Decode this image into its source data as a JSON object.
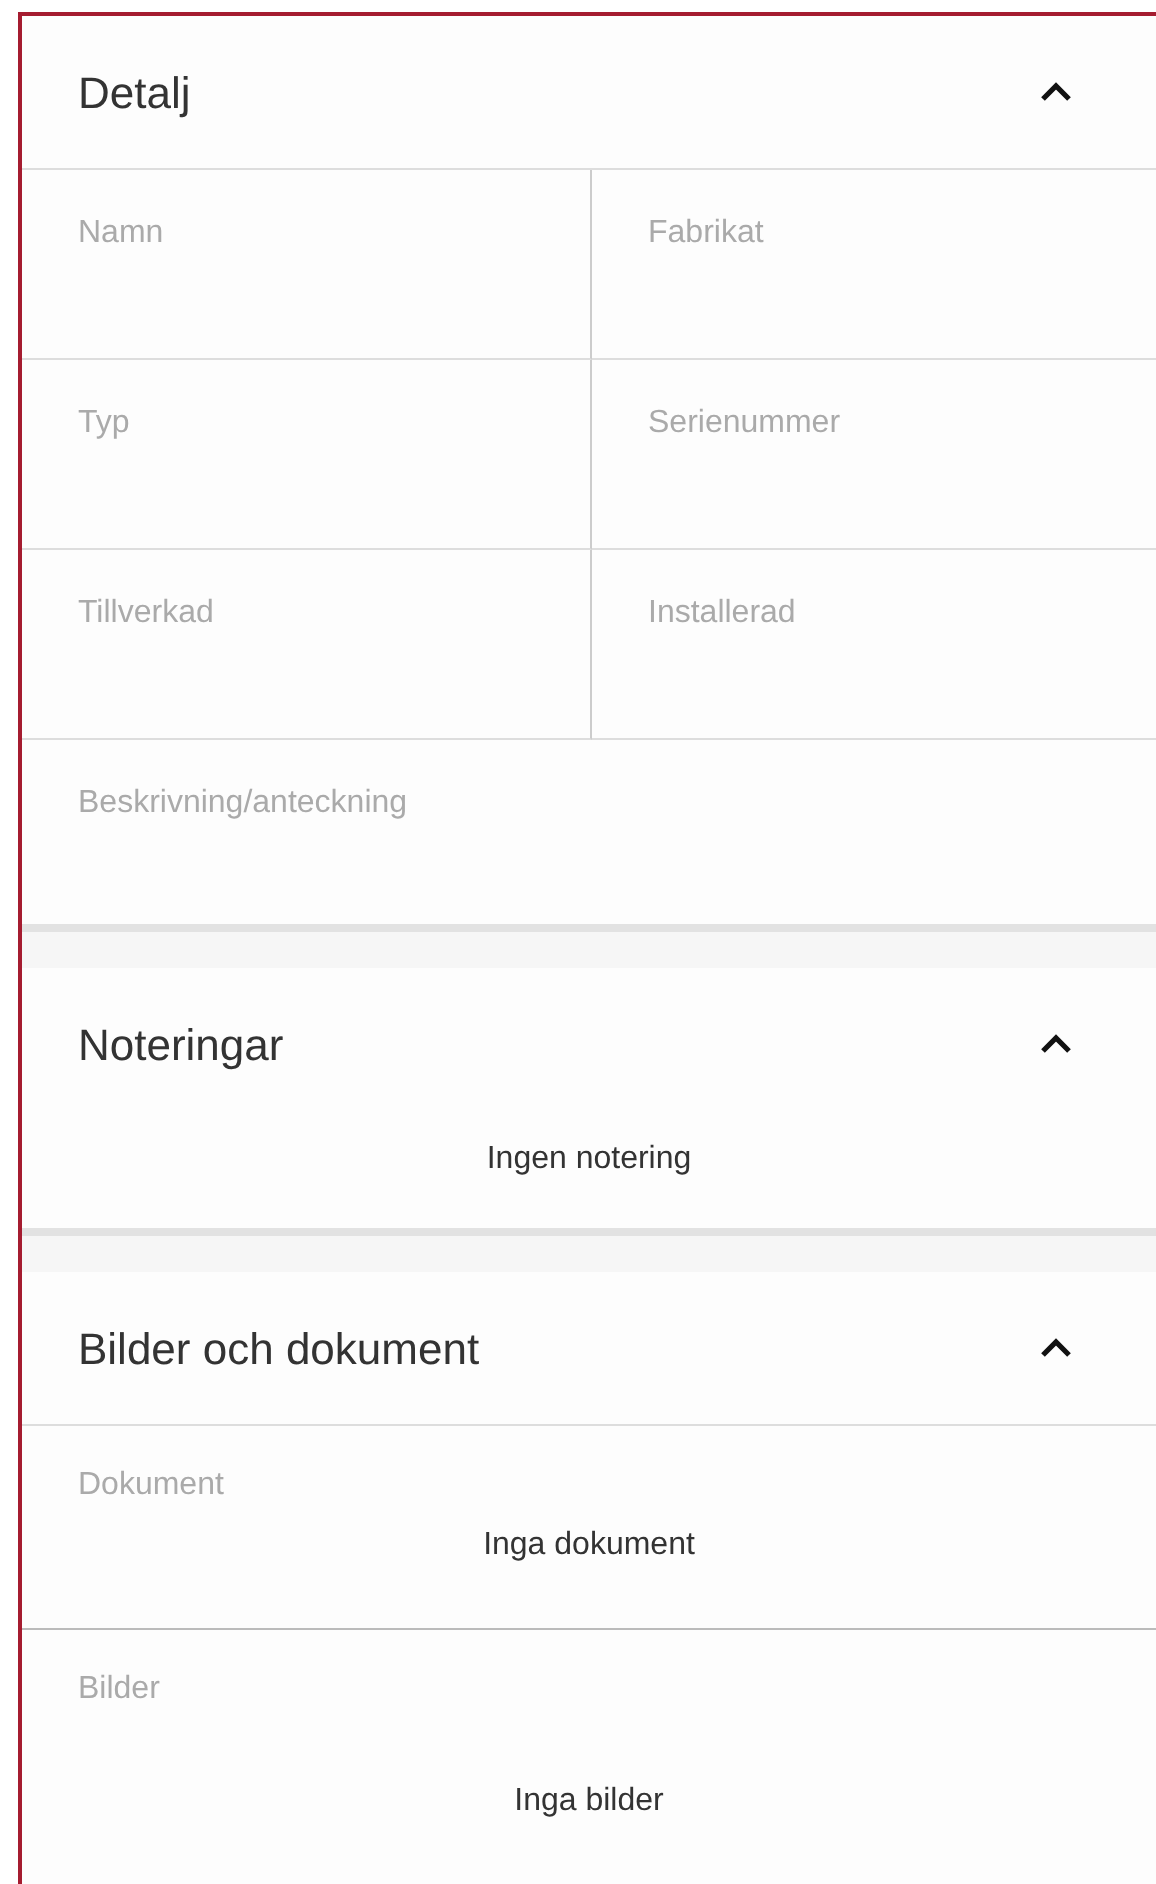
{
  "sections": [
    {
      "kind": "fields",
      "title": "Detalj",
      "expanded": true,
      "fields": [
        {
          "label": "Namn"
        },
        {
          "label": "Fabrikat"
        },
        {
          "label": "Typ"
        },
        {
          "label": "Serienummer"
        },
        {
          "label": "Tillverkad"
        },
        {
          "label": "Installerad"
        },
        {
          "label": "Beskrivning/anteckning",
          "wide": true
        }
      ]
    },
    {
      "kind": "notes",
      "title": "Noteringar",
      "expanded": true,
      "empty_text": "Ingen notering"
    },
    {
      "kind": "files",
      "title": "Bilder och dokument",
      "expanded": true,
      "groups": [
        {
          "label": "Dokument",
          "empty_text": "Inga dokument"
        },
        {
          "label": "Bilder",
          "empty_text": "Inga bilder"
        }
      ]
    }
  ]
}
